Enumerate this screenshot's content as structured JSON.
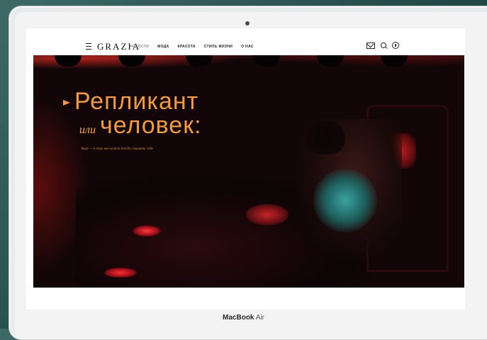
{
  "device": {
    "brand_bold": "MacBook",
    "brand_light": "Air"
  },
  "site": {
    "logo": "GRAZIA",
    "nav": [
      "НОВОСТИ",
      "МОДА",
      "КРАСОТА",
      "СТИЛЬ ЖИЗНИ",
      "О НАС"
    ],
    "icons": [
      "mail-icon",
      "search-icon",
      "user-icon"
    ]
  },
  "hero": {
    "line1": "Репликант",
    "line2_small": "или",
    "line2": "человек:",
    "subtitle": "Анар — о том, как важно всегда слышать себя",
    "accent_color": "#f39a3c"
  }
}
